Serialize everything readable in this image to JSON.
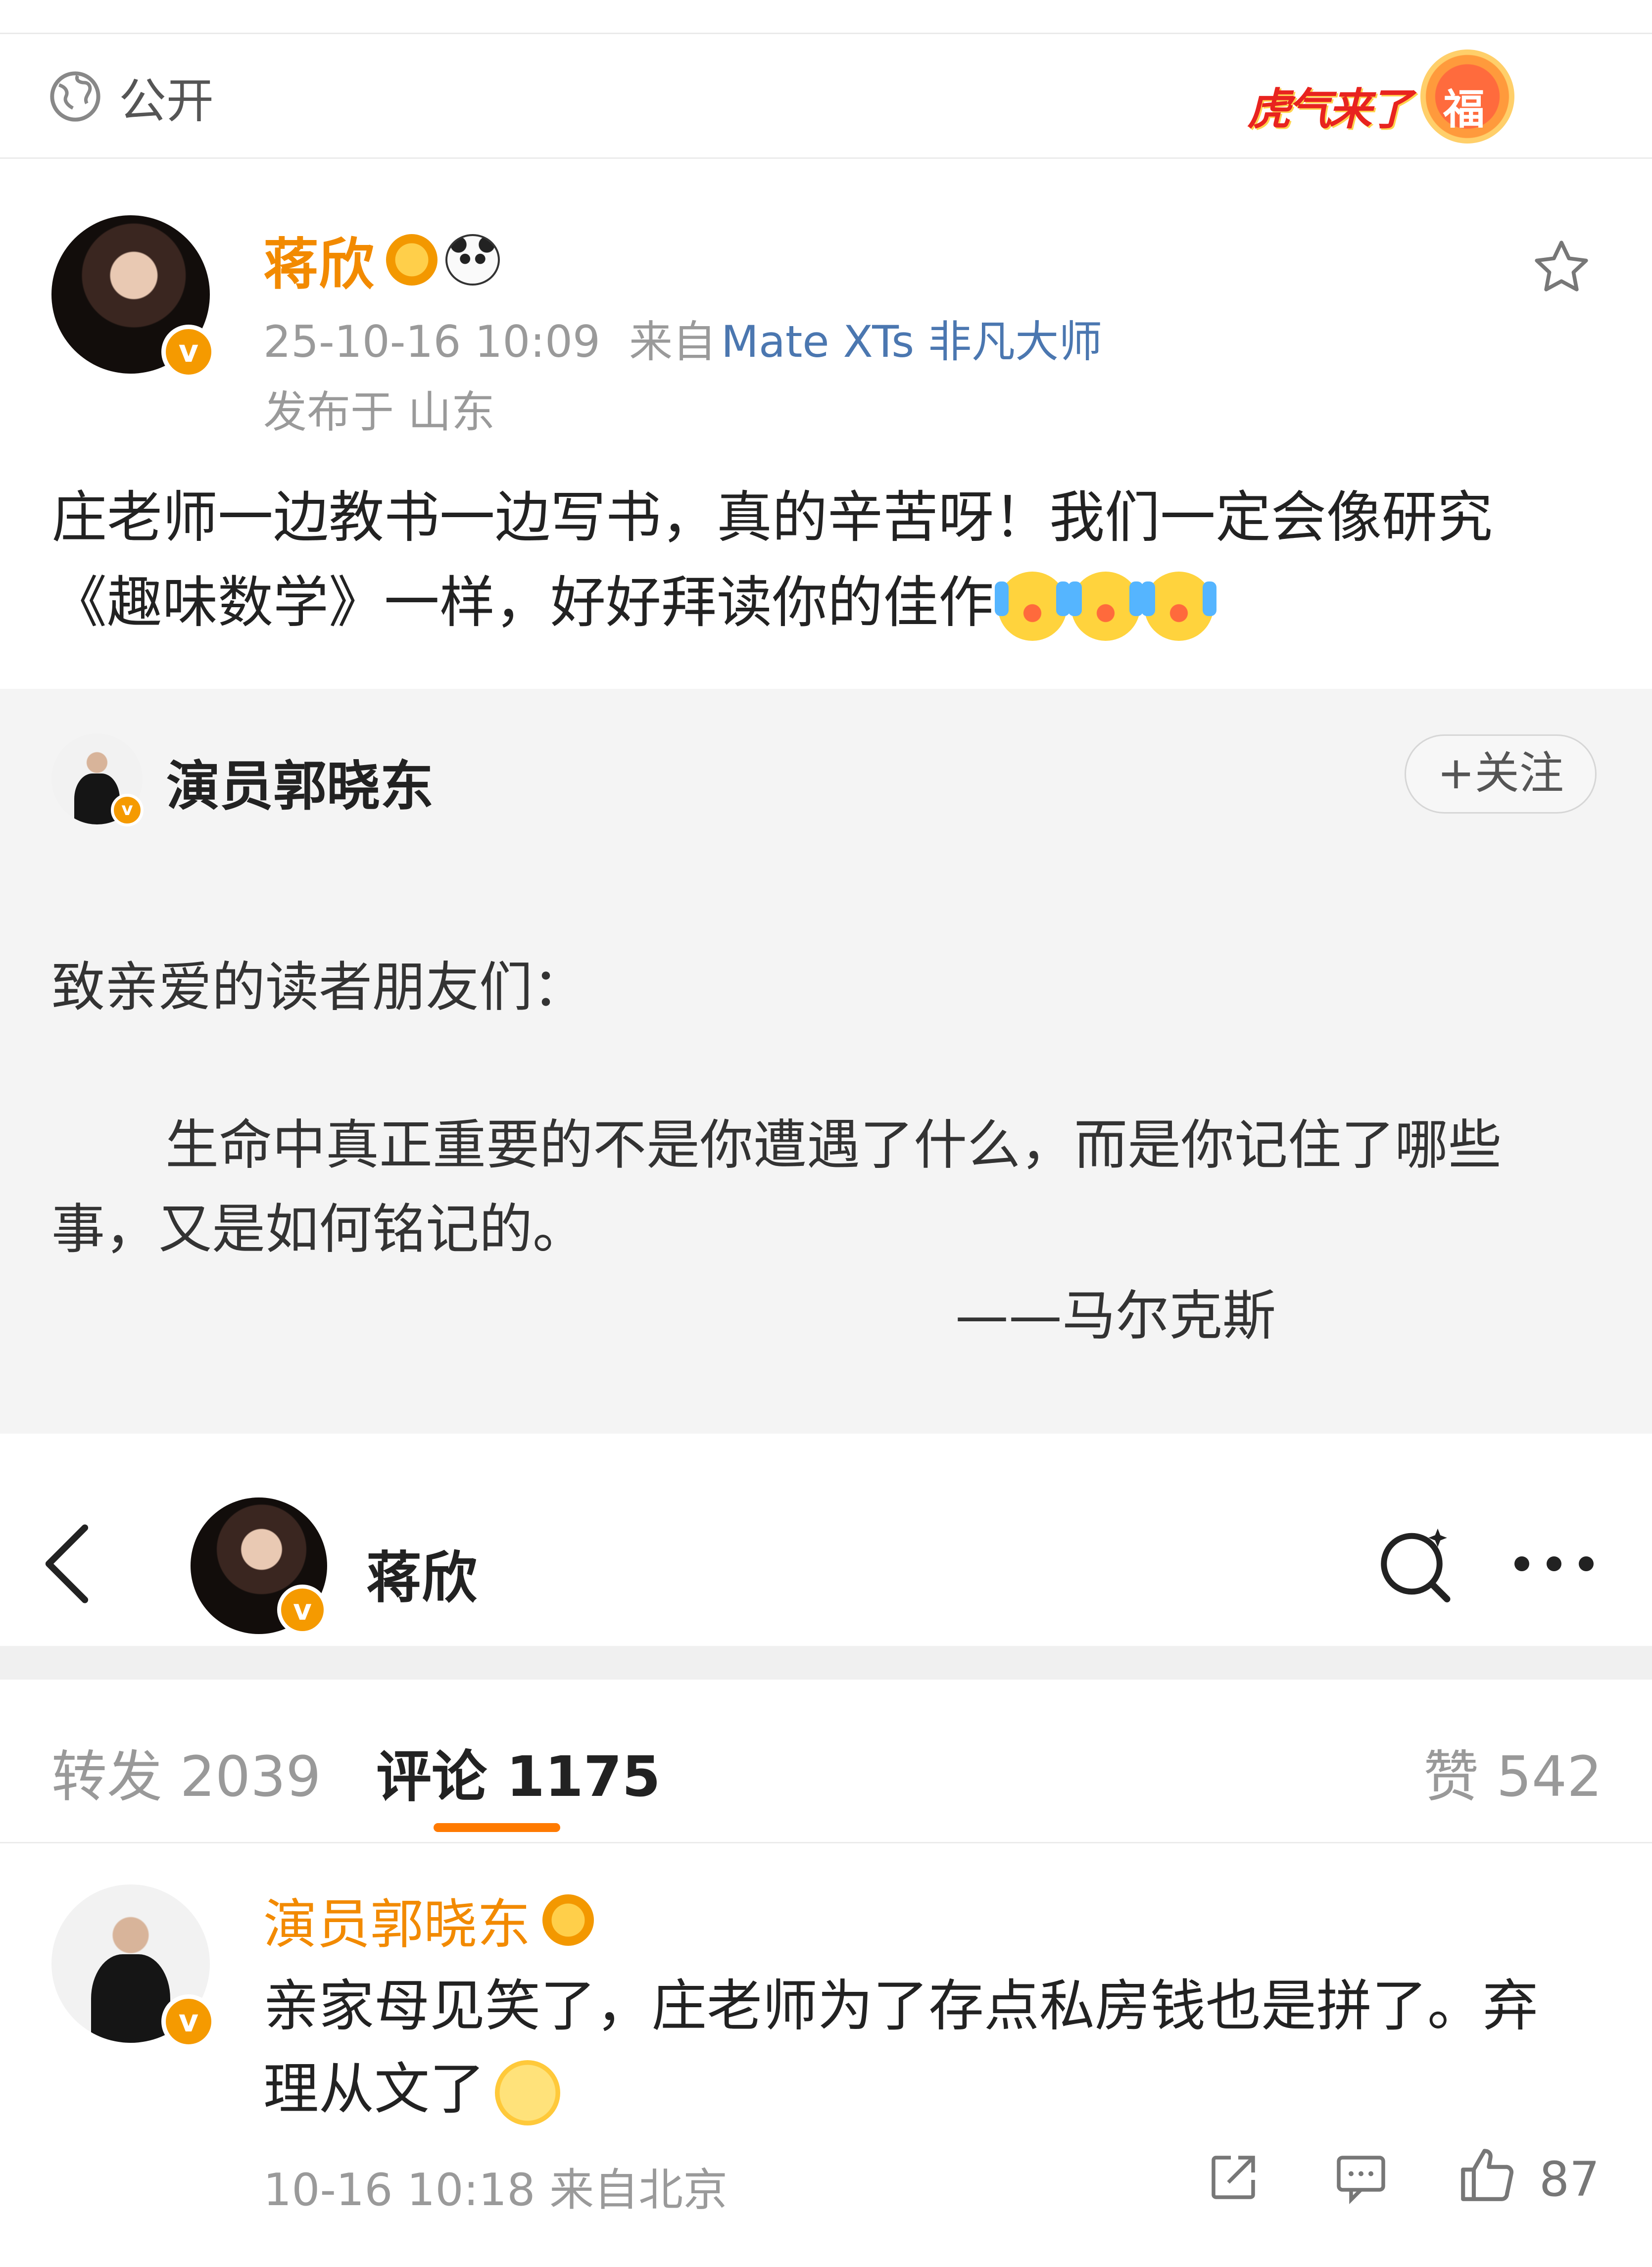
{
  "visibility": {
    "label": "公开"
  },
  "banner": {
    "text": "虎气来了",
    "seal": "福"
  },
  "post": {
    "author": "蒋欣",
    "timestamp": "25-10-16 10:09",
    "source_prefix": "来自",
    "source_device": "Mate XTs 非凡大师",
    "location": "发布于 山东",
    "body": "庄老师一边教书一边写书，真的辛苦呀！我们一定会像研究《趣味数学》一样，好好拜读你的佳作"
  },
  "repost": {
    "author": "演员郭晓东",
    "follow_label": "+关注",
    "greeting": "致亲爱的读者朋友们：",
    "quote": "生命中真正重要的不是你遭遇了什么，而是你记住了哪些事，又是如何铭记的。",
    "signature": "——马尔克斯"
  },
  "header": {
    "title": "蒋欣"
  },
  "tabs": {
    "repost": "转发 2039",
    "comments": "评论 1175",
    "likes": "赞 542"
  },
  "comment": {
    "author": "演员郭晓东",
    "text": "亲家母见笑了，庄老师为了存点私房钱也是拼了。弃理从文了",
    "meta": "10-16 10:18 来自北京",
    "like_count": "87"
  },
  "icons": {
    "visibility": "globe-icon",
    "favorite": "star-icon",
    "back": "chevron-left-icon",
    "search": "search-icon",
    "more": "more-icon",
    "share": "share-icon",
    "reply": "comment-icon",
    "like": "thumbs-up-icon"
  },
  "colors": {
    "accent": "#f28a00",
    "link": "#4b77b0",
    "muted": "#9a9a9a",
    "quote_bg": "#f4f4f4",
    "tab_underline": "#ff7a00"
  }
}
